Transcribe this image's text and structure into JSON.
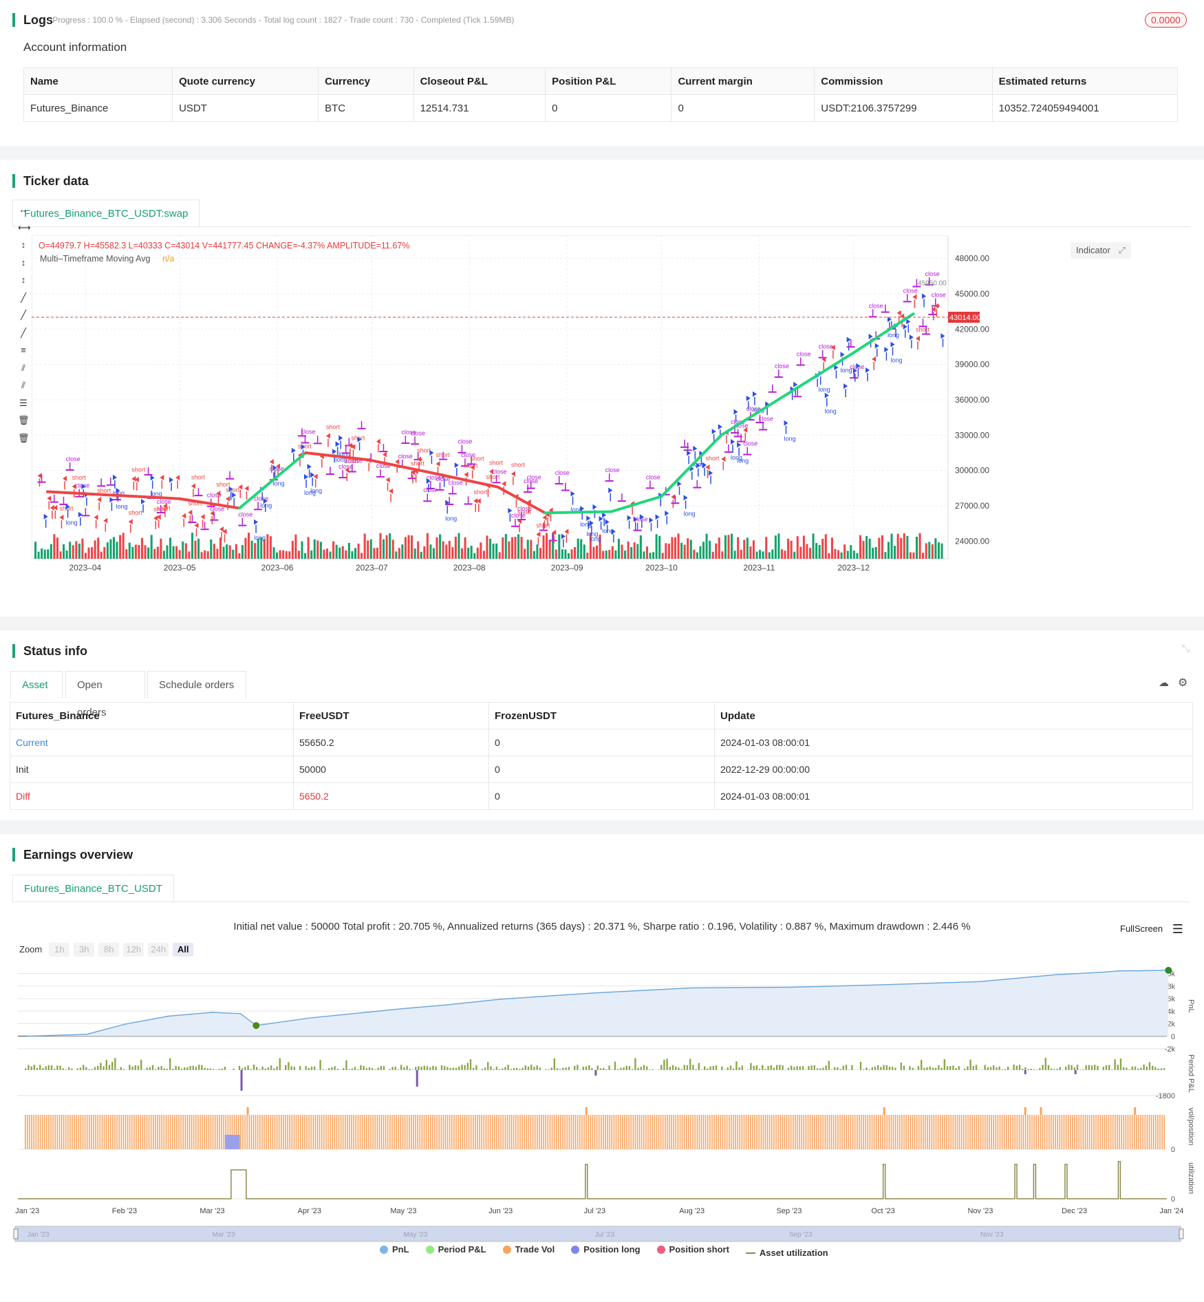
{
  "logs": {
    "title": "Logs",
    "progress_text": "- Progress : 100.0 % - Elapsed (second) : 3.306  Seconds - Total log count : 1827 - Trade count : 730 - Completed (Tick 1.59MB)",
    "badge": "0.0000"
  },
  "account": {
    "title": "Account information",
    "headers": [
      "Name",
      "Quote currency",
      "Currency",
      "Closeout P&L",
      "Position P&L",
      "Current margin",
      "Commission",
      "Estimated returns"
    ],
    "row": [
      "Futures_Binance",
      "USDT",
      "BTC",
      "12514.731",
      "0",
      "0",
      "USDT:2106.3757299",
      "10352.724059494001"
    ]
  },
  "ticker": {
    "title": "Ticker data",
    "tab": "Futures_Binance_BTC_USDT:swap",
    "ohlc": "O=44979.7 H=45582.3 L=40333 C=43014 V=441777.45 CHANGE=-4.37% AMPLITUDE=11.67%",
    "indicator_name": "Multi–Timeframe Moving Avg",
    "indicator_value": "n/a",
    "indicator_button": "Indicator",
    "last_price": "43014.00",
    "marker_price": "45950.00",
    "price_ticks": [
      "48000.00",
      "45000.00",
      "42000.00",
      "39000.00",
      "36000.00",
      "33000.00",
      "30000.00",
      "27000.00",
      "24000.00"
    ],
    "date_ticks": [
      "2023–04",
      "2023–05",
      "2023–06",
      "2023–07",
      "2023–08",
      "2023–09",
      "2023–10",
      "2023–11",
      "2023–12"
    ],
    "signal_labels": [
      "close",
      "short",
      "long"
    ]
  },
  "status": {
    "title": "Status info",
    "tabs": [
      "Asset",
      "Open orders",
      "Schedule orders"
    ],
    "headers": [
      "Futures_Binance",
      "FreeUSDT",
      "FrozenUSDT",
      "Update"
    ],
    "rows": [
      [
        "Current",
        "55650.2",
        "0",
        "2024-01-03 08:00:01"
      ],
      [
        "Init",
        "50000",
        "0",
        "2022-12-29 00:00:00"
      ],
      [
        "Diff",
        "5650.2",
        "0",
        "2024-01-03 08:00:01"
      ]
    ]
  },
  "earnings": {
    "title": "Earnings overview",
    "tab": "Futures_Binance_BTC_USDT",
    "summary": "Initial net value : 50000 Total profit : 20.705 %, Annualized returns (365 days) : 20.371 %, Sharpe ratio : 0.196, Volatility : 0.887 %, Maximum drawdown : 2.446 %",
    "fullscreen": "FullScreen",
    "zoom_label": "Zoom",
    "zoom_buttons": [
      "1h",
      "3h",
      "8h",
      "12h",
      "24h",
      "All"
    ],
    "pnl_ticks": [
      "10k",
      "8k",
      "6k",
      "4k",
      "2k",
      "0",
      "-2k"
    ],
    "period_tick": "-1800",
    "axis_titles": [
      "PnL",
      "Period P&L",
      "vol/position",
      "utilization"
    ],
    "zero_label": "0",
    "month_ticks": [
      "Jan '23",
      "Feb '23",
      "Mar '23",
      "Apr '23",
      "May '23",
      "Jun '23",
      "Jul '23",
      "Aug '23",
      "Sep '23",
      "Oct '23",
      "Nov '23",
      "Dec '23",
      "Jan '24"
    ],
    "navigator_ticks": [
      "Jan '23",
      "Mar '23",
      "May '23",
      "Jul '23",
      "Sep '23",
      "Nov '23"
    ],
    "legend": [
      {
        "label": "PnL",
        "color": "#7cb5ec"
      },
      {
        "label": "Period P&L",
        "color": "#90ed7d"
      },
      {
        "label": "Trade Vol",
        "color": "#f7a35c"
      },
      {
        "label": "Position long",
        "color": "#8085e9"
      },
      {
        "label": "Position short",
        "color": "#f15c80"
      },
      {
        "label": "Asset utilization",
        "color": "#8d8a4a"
      }
    ]
  },
  "chart_data": [
    {
      "type": "line",
      "title": "",
      "x_range": [
        "2023-03-15",
        "2023-12-31"
      ],
      "ylim": [
        22500,
        49500
      ],
      "series": [
        {
          "name": "Multi–Timeframe Moving Avg",
          "x": [
            "2023-03-20",
            "2023-04-10",
            "2023-05-01",
            "2023-05-20",
            "2023-06-10",
            "2023-06-30",
            "2023-07-20",
            "2023-08-10",
            "2023-08-25",
            "2023-09-15",
            "2023-10-01",
            "2023-10-20",
            "2023-11-10",
            "2023-12-01",
            "2023-12-20"
          ],
          "values": [
            28200,
            27900,
            27600,
            26800,
            31500,
            30900,
            29800,
            28600,
            26400,
            26500,
            27800,
            33000,
            36500,
            40000,
            43300
          ]
        }
      ],
      "last_close": 43014
    },
    {
      "type": "area",
      "title": "",
      "ylabel": "PnL",
      "x": [
        "2023-01-01",
        "2023-01-20",
        "2023-02-01",
        "2023-02-15",
        "2023-03-01",
        "2023-03-10",
        "2023-03-15",
        "2023-04-01",
        "2023-05-01",
        "2023-05-15",
        "2023-06-01",
        "2023-07-01",
        "2023-08-01",
        "2023-09-01",
        "2023-10-01",
        "2023-11-01",
        "2023-11-25",
        "2023-12-10",
        "2023-12-15",
        "2023-12-31"
      ],
      "values": [
        0,
        300,
        1900,
        3200,
        3800,
        3600,
        1700,
        2900,
        4400,
        5000,
        5900,
        6900,
        7700,
        7800,
        8200,
        8700,
        9800,
        10200,
        10400,
        10500
      ],
      "ylim": [
        -2000,
        10500
      ]
    }
  ]
}
